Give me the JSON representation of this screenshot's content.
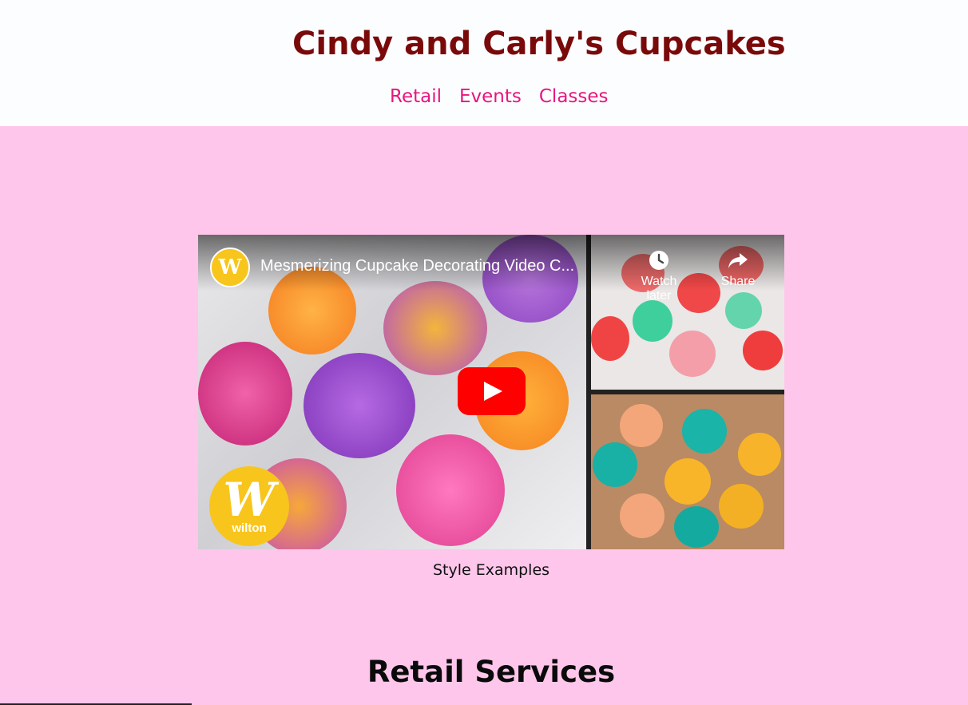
{
  "site": {
    "title": "Cindy and Carly's Cupcakes"
  },
  "nav": {
    "items": [
      "Retail",
      "Events",
      "Classes"
    ]
  },
  "video": {
    "title": "Mesmerizing Cupcake Decorating Video C...",
    "channel_badge": "W",
    "logo_mark": "W",
    "logo_text": "wilton",
    "watch_later_label": "Watch later",
    "share_label": "Share"
  },
  "caption": "Style Examples",
  "section": {
    "title": "Retail Services"
  },
  "colors": {
    "header_bg": "#fcfdff",
    "page_bg": "#fec6ea",
    "title": "#7a0a0a",
    "nav_link": "#e8157f",
    "play_button": "#ff0000",
    "brand_yellow": "#f8c51c"
  }
}
